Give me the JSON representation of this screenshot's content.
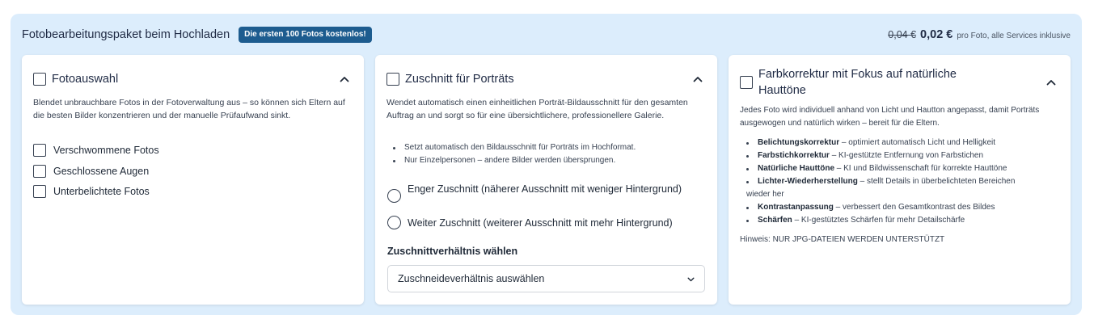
{
  "header": {
    "title": "Fotobearbeitungspaket beim Hochladen",
    "badge": "Die ersten 100 Fotos kostenlos!",
    "price_old": "0,04 €",
    "price_new": "0,02 €",
    "price_note": "pro Foto, alle Services inklusive"
  },
  "cards": [
    {
      "title": "Fotoauswahl",
      "description": "Blendet unbrauchbare Fotos in der Fotoverwaltung aus – so können sich Eltern auf die besten Bilder konzentrieren und der manuelle Prüfaufwand sinkt.",
      "options": [
        "Verschwommene Fotos",
        "Geschlossene Augen",
        "Unterbelichtete Fotos"
      ]
    },
    {
      "title": "Zuschnitt für Porträts",
      "description": "Wendet automatisch einen einheitlichen Porträt-Bildausschnitt für den gesamten Auftrag an und sorgt so für eine übersichtlichere, professionellere Galerie.",
      "bullets": [
        "Setzt automatisch den Bildausschnitt für Porträts im Hochformat.",
        "Nur Einzelpersonen – andere Bilder werden übersprungen."
      ],
      "radios": [
        "Enger Zuschnitt (näherer Ausschnitt mit weniger Hintergrund)",
        "Weiter Zuschnitt (weiterer Ausschnitt mit mehr Hintergrund)"
      ],
      "ratio_label": "Zuschnittverhältnis wählen",
      "ratio_placeholder": "Zuschneideverhältnis auswählen"
    },
    {
      "title": "Farbkorrektur mit Fokus auf natürliche Hauttöne",
      "description": "Jedes Foto wird individuell anhand von Licht und Hautton angepasst, damit Porträts ausgewogen und natürlich wirken – bereit für die Eltern.",
      "bullets": [
        {
          "term": "Belichtungskorrektur",
          "text": " – optimiert automatisch Licht und Helligkeit"
        },
        {
          "term": "Farbstichkorrektur",
          "text": " – KI-gestützte Entfernung von Farbstichen"
        },
        {
          "term": "Natürliche Hauttöne",
          "text": " – KI und Bildwissenschaft für korrekte Hauttöne"
        },
        {
          "term": "Lichter-Wiederherstellung",
          "text": " – stellt Details in überbelichteten Bereichen"
        },
        {
          "term": "Kontrastanpassung",
          "text": " – verbessert den Gesamtkontrast des Bildes"
        },
        {
          "term": "Schärfen",
          "text": " – KI-gestütztes Schärfen für mehr Detailschärfe"
        }
      ],
      "bullet_continuation": "wieder her",
      "note": "Hinweis: NUR JPG-DATEIEN WERDEN UNTERSTÜTZT"
    }
  ]
}
